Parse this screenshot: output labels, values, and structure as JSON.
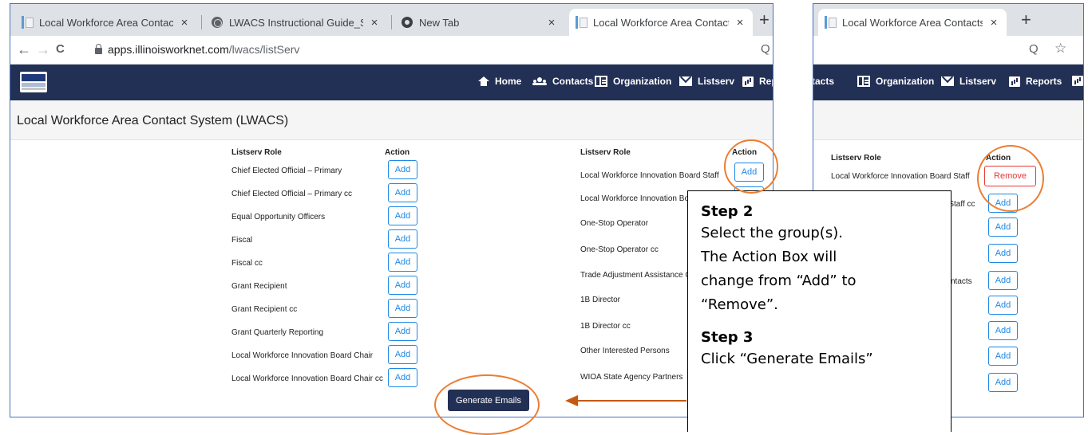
{
  "browser_main": {
    "tabs": [
      {
        "title": "Local Workforce Area Contacts Sy",
        "favicon": "doc-favicon"
      },
      {
        "title": "LWACS Instructional Guide_Septe",
        "favicon": "globe-icon"
      },
      {
        "title": "New Tab",
        "favicon": "chrome-icon"
      },
      {
        "title": "Local Workforce Area Contacts Sy",
        "favicon": "doc-favicon",
        "active": true
      }
    ],
    "close_glyph": "×",
    "new_tab_glyph": "+",
    "nav": {
      "back": "←",
      "forward": "→",
      "reload": "C"
    },
    "url_host": "apps.illinoisworknet.com",
    "url_path": "/lwacs/listServ",
    "zoom_glyph": "Q"
  },
  "site_nav": {
    "items": [
      {
        "label": "Home",
        "icon": "home-icon"
      },
      {
        "label": "Contacts",
        "icon": "contacts-icon"
      },
      {
        "label": "Organization",
        "icon": "organization-icon"
      },
      {
        "label": "Listserv",
        "icon": "mail-icon"
      },
      {
        "label": "Rep",
        "icon": "reports-icon"
      }
    ]
  },
  "page_title": "Local Workforce Area Contact System (LWACS)",
  "left_table": {
    "role_header": "Listserv Role",
    "action_header": "Action",
    "rows": [
      {
        "role": "Chief Elected Official – Primary",
        "action": "Add"
      },
      {
        "role": "Chief Elected Official – Primary cc",
        "action": "Add"
      },
      {
        "role": "Equal Opportunity Officers",
        "action": "Add"
      },
      {
        "role": "Fiscal",
        "action": "Add"
      },
      {
        "role": "Fiscal cc",
        "action": "Add"
      },
      {
        "role": "Grant Recipient",
        "action": "Add"
      },
      {
        "role": "Grant Recipient cc",
        "action": "Add"
      },
      {
        "role": "Grant Quarterly Reporting",
        "action": "Add"
      },
      {
        "role": "Local Workforce Innovation Board Chair",
        "action": "Add"
      },
      {
        "role": "Local Workforce Innovation Board Chair cc",
        "action": "Add"
      }
    ]
  },
  "right_table": {
    "role_header": "Listserv Role",
    "action_header": "Action",
    "rows": [
      {
        "role": "Local Workforce Innovation Board Staff",
        "action": "Add"
      },
      {
        "role": "Local Workforce Innovation Bo",
        "action": "Add"
      },
      {
        "role": "One-Stop Operator"
      },
      {
        "role": "One-Stop Operator cc"
      },
      {
        "role": "Trade Adjustment Assistance C"
      },
      {
        "role": "1B Director"
      },
      {
        "role": "1B Director cc"
      },
      {
        "role": "Other Interested Persons"
      },
      {
        "role": "WIOA State Agency Partners"
      }
    ]
  },
  "generate_button": "Generate Emails",
  "browser_zoomed": {
    "tab_title": "Local Workforce Area Contacts S",
    "close_glyph": "×",
    "new_tab_glyph": "+",
    "zoom_glyph": "Q",
    "star_glyph": "☆",
    "nav_items": [
      {
        "label": "tacts"
      },
      {
        "label": "Organization",
        "icon": "organization-icon"
      },
      {
        "label": "Listserv",
        "icon": "mail-icon"
      },
      {
        "label": "Reports",
        "icon": "reports-icon"
      }
    ],
    "role_header": "Listserv Role",
    "action_header": "Action",
    "row1_role": "Local Workforce Innovation Board Staff",
    "row1_action": "Remove",
    "row2_role": "d Staff cc",
    "row2_action": "Add",
    "row5_role": "ntacts",
    "add_label": "Add"
  },
  "callout": {
    "step2_title": "Step 2",
    "step2_lines": [
      "Select the group(s).",
      "The Action Box will",
      "change from “Add” to",
      "“Remove”."
    ],
    "step3_title": "Step 3",
    "step3_line": "Click “Generate Emails”"
  },
  "colors": {
    "nav_bg": "#233055",
    "button_blue": "#1e88e5",
    "remove_red": "#e53935",
    "annotation_orange": "#ed7d31",
    "window_border": "#4472c4"
  }
}
